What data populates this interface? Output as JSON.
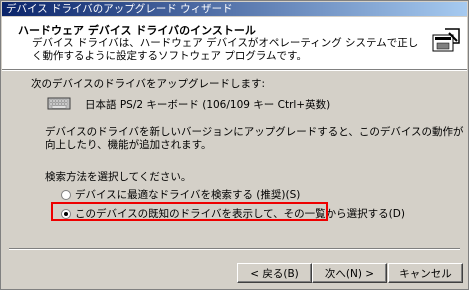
{
  "window": {
    "title": "デバイス ドライバのアップグレード ウィザード"
  },
  "header": {
    "title": "ハードウェア デバイス ドライバのインストール",
    "description": "デバイス ドライバは、ハードウェア デバイスがオペレーティング システムで正しく動作するように設定するソフトウェア プログラムです。"
  },
  "main": {
    "upgrade_label": "次のデバイスのドライバをアップグレードします:",
    "device_name": "日本語 PS/2 キーボード (106/109 キー Ctrl+英数)",
    "info": "デバイスのドライバを新しいバージョンにアップグレードすると、このデバイスの動作が向上したり、機能が追加されます。",
    "method_label": "検索方法を選択してください。",
    "options": [
      {
        "label": "デバイスに最適なドライバを検索する (推奨)(S)",
        "checked": false
      },
      {
        "label": "このデバイスの既知のドライバを表示して、その一覧から選択する(D)",
        "checked": true
      }
    ]
  },
  "buttons": {
    "back": "< 戻る(B)",
    "next": "次へ(N) >",
    "cancel": "キャンセル"
  },
  "colors": {
    "highlight": "#e00000",
    "title_bar": "#0a246a"
  }
}
